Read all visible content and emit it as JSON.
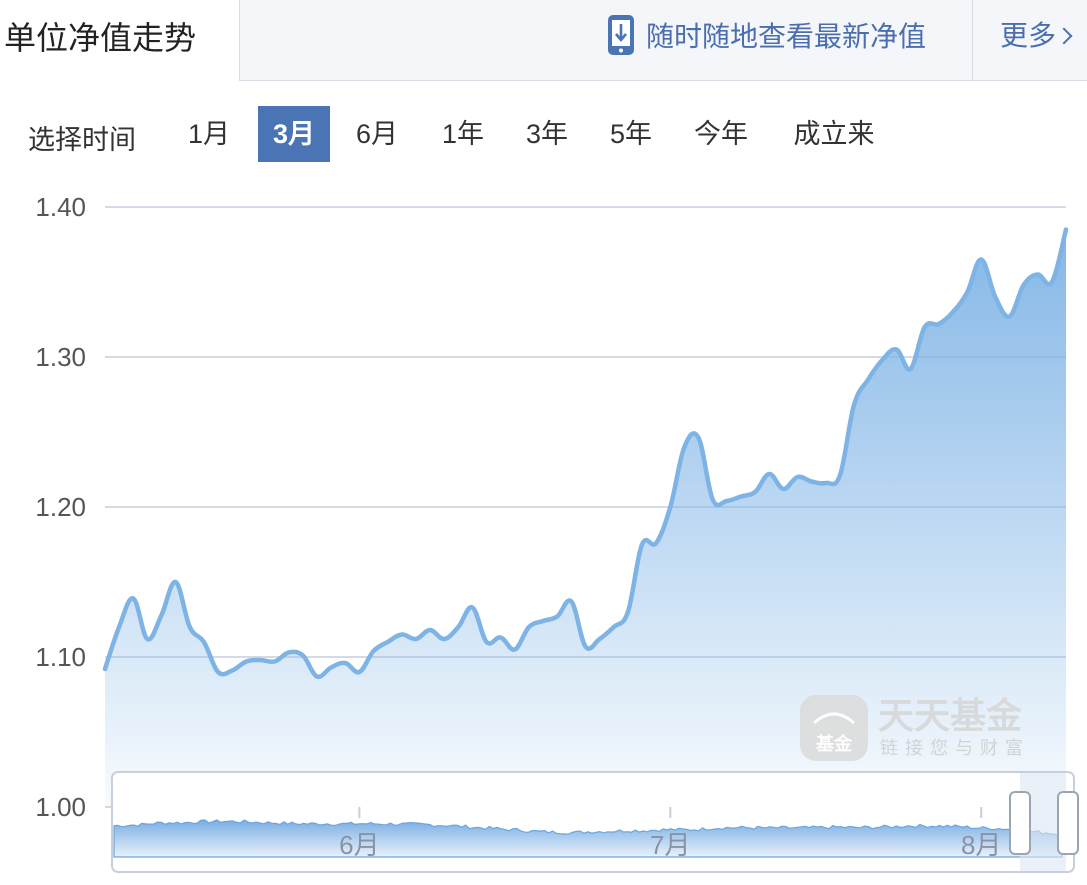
{
  "header": {
    "title": "单位净值走势",
    "app_link": "随时随地查看最新净值",
    "more": "更多"
  },
  "time_selector": {
    "label": "选择时间",
    "options": [
      "1月",
      "3月",
      "6月",
      "1年",
      "3年",
      "5年",
      "今年",
      "成立来"
    ],
    "selected": "3月"
  },
  "watermark": {
    "brand": "天天基金",
    "slogan": "链接您与财富",
    "logo_text": "基金"
  },
  "colors": {
    "line": "#7eb3e6",
    "accent": "#4a74b4",
    "link": "#4b6fae"
  },
  "chart_data": {
    "type": "area",
    "title": "单位净值走势",
    "xlabel": "",
    "ylabel": "",
    "ylim": [
      1.0,
      1.4
    ],
    "y_ticks": [
      "1.40",
      "1.30",
      "1.20",
      "1.10",
      "1.00"
    ],
    "x_month_labels": [
      {
        "label": "6月",
        "index": 18
      },
      {
        "label": "7月",
        "index": 40
      },
      {
        "label": "8月",
        "index": 62
      }
    ],
    "grid": true,
    "series": [
      {
        "values": [
          1.092,
          1.12,
          1.139,
          1.112,
          1.128,
          1.15,
          1.12,
          1.11,
          1.09,
          1.091,
          1.097,
          1.098,
          1.097,
          1.103,
          1.101,
          1.087,
          1.093,
          1.096,
          1.09,
          1.104,
          1.11,
          1.115,
          1.112,
          1.118,
          1.112,
          1.12,
          1.133,
          1.11,
          1.113,
          1.105,
          1.12,
          1.124,
          1.127,
          1.137,
          1.107,
          1.112,
          1.12,
          1.13,
          1.175,
          1.176,
          1.2,
          1.24,
          1.246,
          1.205,
          1.204,
          1.207,
          1.21,
          1.222,
          1.212,
          1.22,
          1.217,
          1.216,
          1.221,
          1.268,
          1.285,
          1.298,
          1.305,
          1.292,
          1.32,
          1.322,
          1.33,
          1.343,
          1.365,
          1.34,
          1.327,
          1.348,
          1.355,
          1.35,
          1.385
        ]
      }
    ]
  }
}
